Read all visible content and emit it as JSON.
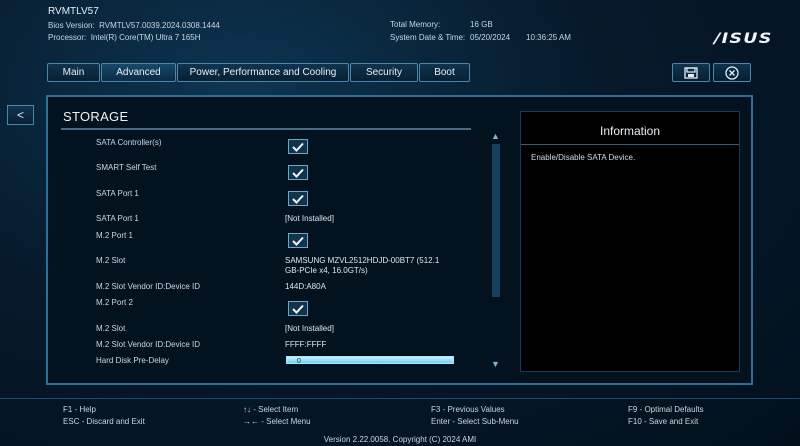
{
  "header": {
    "model": "RVMTLV57",
    "bios_label": "Bios Version:",
    "bios_value": "RVMTLV57.0039.2024.0308.1444",
    "processor_label": "Processor:",
    "processor_value": "Intel(R) Core(TM) Ultra 7 165H",
    "memory_label": "Total Memory:",
    "memory_value": "16 GB",
    "datetime_label": "System Date & Time:",
    "date_value": "05/20/2024",
    "time_value": "10:36:25 AM",
    "logo_text": "/ISUS"
  },
  "tabs": [
    {
      "label": "Main"
    },
    {
      "label": "Advanced"
    },
    {
      "label": "Power, Performance and Cooling"
    },
    {
      "label": "Security"
    },
    {
      "label": "Boot"
    }
  ],
  "back_label": "<",
  "panel": {
    "title": "STORAGE",
    "settings": [
      {
        "label": "SATA Controller(s)",
        "type": "checkbox",
        "checked": true
      },
      {
        "label": "SMART Self Test",
        "type": "checkbox",
        "checked": true
      },
      {
        "label": "SATA Port 1",
        "type": "checkbox",
        "checked": true
      },
      {
        "label": "SATA Port 1",
        "value": "[Not Installed]"
      },
      {
        "label": "M.2 Port 1",
        "type": "checkbox",
        "checked": true
      },
      {
        "label": "M.2 Slot",
        "value_line1": "SAMSUNG MZVL2512HDJD-00BT7 (512.1",
        "value_line2": "GB-PCIe x4, 16.0GT/s)"
      },
      {
        "label": "M.2 Slot Vendor ID:Device ID",
        "value": "144D:A80A"
      },
      {
        "label": "M.2 Port 2",
        "type": "checkbox",
        "checked": true
      },
      {
        "label": "M.2 Slot",
        "value": "[Not Installed]"
      },
      {
        "label": "M.2 Slot Vendor ID:Device ID",
        "value": "FFFF:FFFF"
      },
      {
        "label": "Hard Disk Pre-Delay",
        "value": "0"
      }
    ]
  },
  "info": {
    "title": "Information",
    "text": "Enable/Disable SATA Device."
  },
  "help": {
    "f1": "F1 - Help",
    "esc": "ESC - Discard and Exit",
    "arrows": "↑↓ - Select Item",
    "enter_arrow": "→← - Select Menu",
    "f3": "F3 - Previous Values",
    "enter": "Enter - Select Sub-Menu",
    "f9": "F9 - Optimal Defaults",
    "f10": "F10 - Save and Exit"
  },
  "version": "Version 2.22.0058. Copyright (C) 2024 AMI",
  "colors": {
    "accent": "#2f6f96",
    "slider": "#6fd1f2",
    "background": "#061a2b"
  }
}
